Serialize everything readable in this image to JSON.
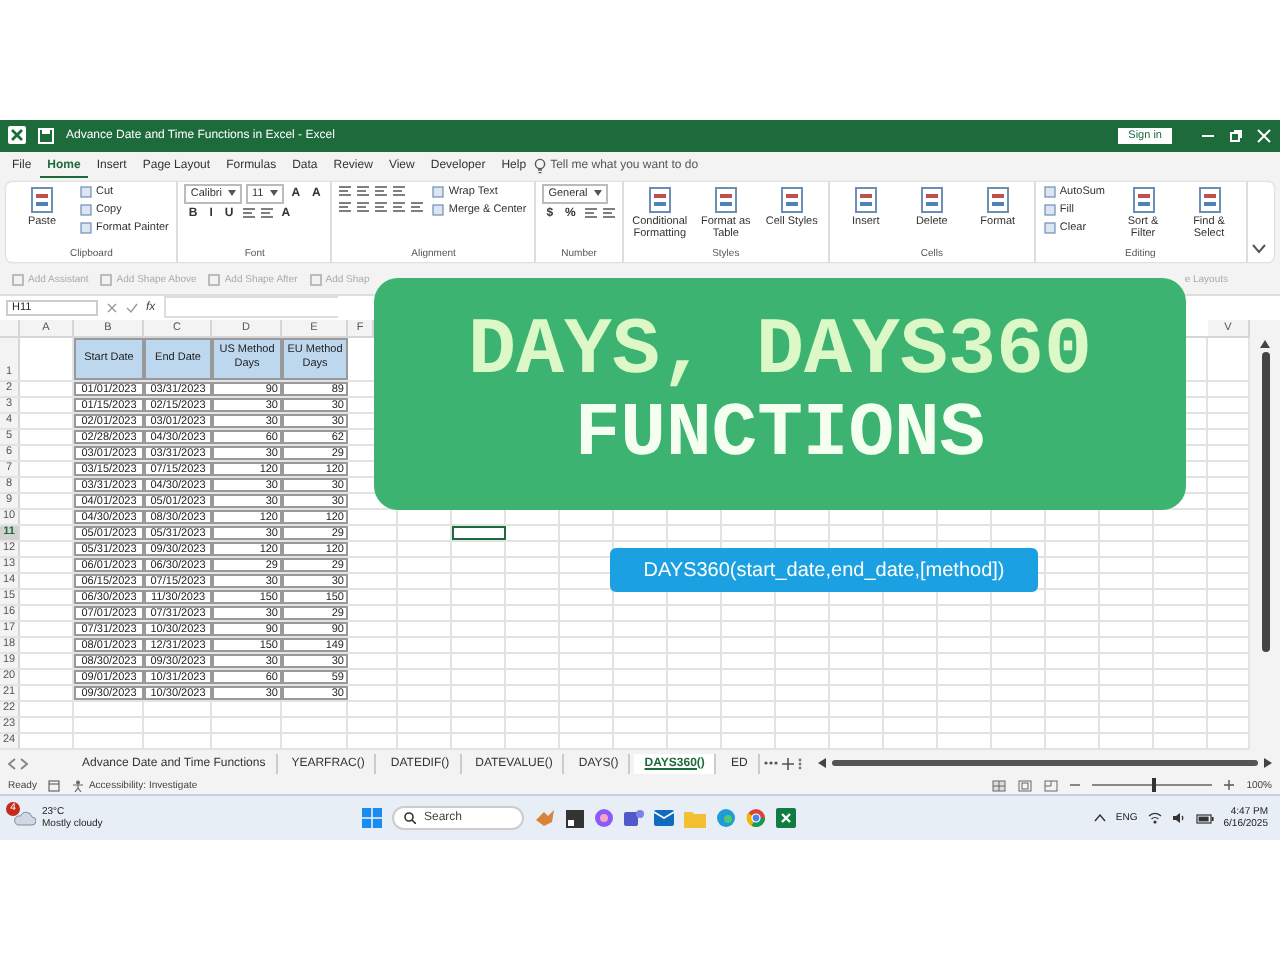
{
  "window": {
    "title": "Advance Date and Time Functions in Excel  -  Excel",
    "sign_in": "Sign in"
  },
  "menu": {
    "tabs": [
      {
        "label": "File",
        "selected": false
      },
      {
        "label": "Home",
        "selected": true
      },
      {
        "label": "Insert",
        "selected": false
      },
      {
        "label": "Page Layout",
        "selected": false
      },
      {
        "label": "Formulas",
        "selected": false
      },
      {
        "label": "Data",
        "selected": false
      },
      {
        "label": "Review",
        "selected": false
      },
      {
        "label": "View",
        "selected": false
      },
      {
        "label": "Developer",
        "selected": false
      },
      {
        "label": "Help",
        "selected": false
      }
    ],
    "tell_me": "Tell me what you want to do"
  },
  "ribbon": {
    "groups": [
      {
        "label": "Clipboard",
        "columns": [
          [
            [
              {
                "kind": "large",
                "label": "Paste"
              }
            ]
          ],
          [
            [
              {
                "kind": "small",
                "label": "Cut"
              }
            ],
            [
              {
                "kind": "small",
                "label": "Copy"
              }
            ],
            [
              {
                "kind": "small",
                "label": "Format Painter"
              }
            ]
          ]
        ]
      },
      {
        "label": "Font",
        "columns": [
          [
            [
              {
                "kind": "field",
                "label": "Calibri"
              },
              {
                "kind": "field",
                "label": "11"
              },
              {
                "kind": "glyph",
                "label": "A"
              },
              {
                "kind": "glyph",
                "label": "A"
              }
            ],
            [
              {
                "kind": "glyph",
                "label": "B"
              },
              {
                "kind": "glyph",
                "label": "I"
              },
              {
                "kind": "glyph",
                "label": "U"
              },
              {
                "kind": "tool"
              },
              {
                "kind": "tool"
              },
              {
                "kind": "glyph",
                "label": "A"
              }
            ]
          ]
        ]
      },
      {
        "label": "Alignment",
        "columns": [
          [
            [
              {
                "kind": "tool"
              },
              {
                "kind": "tool"
              },
              {
                "kind": "tool"
              },
              {
                "kind": "tool"
              }
            ],
            [
              {
                "kind": "tool"
              },
              {
                "kind": "tool"
              },
              {
                "kind": "tool"
              },
              {
                "kind": "tool"
              },
              {
                "kind": "tool"
              }
            ]
          ],
          [
            [
              {
                "kind": "small",
                "label": "Wrap Text"
              }
            ],
            [
              {
                "kind": "small",
                "label": "Merge & Center"
              }
            ]
          ]
        ]
      },
      {
        "label": "Number",
        "columns": [
          [
            [
              {
                "kind": "field",
                "label": "General"
              }
            ],
            [
              {
                "kind": "glyph",
                "label": "$"
              },
              {
                "kind": "glyph",
                "label": "%"
              },
              {
                "kind": "tool"
              },
              {
                "kind": "tool"
              }
            ]
          ]
        ]
      },
      {
        "label": "Styles",
        "columns": [
          [
            [
              {
                "kind": "large",
                "label": "Conditional Formatting"
              }
            ]
          ],
          [
            [
              {
                "kind": "large",
                "label": "Format as Table"
              }
            ]
          ],
          [
            [
              {
                "kind": "large",
                "label": "Cell Styles"
              }
            ]
          ]
        ]
      },
      {
        "label": "Cells",
        "columns": [
          [
            [
              {
                "kind": "large",
                "label": "Insert"
              }
            ]
          ],
          [
            [
              {
                "kind": "large",
                "label": "Delete"
              }
            ]
          ],
          [
            [
              {
                "kind": "large",
                "label": "Format"
              }
            ]
          ]
        ]
      },
      {
        "label": "Editing",
        "columns": [
          [
            [
              {
                "kind": "small",
                "label": "AutoSum"
              }
            ],
            [
              {
                "kind": "small",
                "label": "Fill"
              }
            ],
            [
              {
                "kind": "small",
                "label": "Clear"
              }
            ]
          ],
          [
            [
              {
                "kind": "large",
                "label": "Sort & Filter"
              }
            ]
          ],
          [
            [
              {
                "kind": "large",
                "label": "Find & Select"
              }
            ]
          ]
        ]
      }
    ]
  },
  "toolbar": {
    "items": [
      "Add Assistant",
      "Add Shape Above",
      "Add Shape After",
      "Add Shap"
    ],
    "right": "e Layouts"
  },
  "formula_bar": {
    "name_box": "H11",
    "function_label": "fx"
  },
  "sheet": {
    "column_headers": [
      "A",
      "B",
      "C",
      "D",
      "E",
      "F",
      "V"
    ],
    "rows": [
      {
        "header": "1",
        "kind": "header",
        "selected": false,
        "cells": [
          "Start Date",
          "End Date",
          "US Method Days",
          "EU Method Days"
        ]
      },
      {
        "header": "2",
        "kind": "data",
        "selected": false,
        "cells": [
          "01/01/2023",
          "03/31/2023",
          "90",
          "89"
        ]
      },
      {
        "header": "3",
        "kind": "data",
        "selected": false,
        "cells": [
          "01/15/2023",
          "02/15/2023",
          "30",
          "30"
        ]
      },
      {
        "header": "4",
        "kind": "data",
        "selected": false,
        "cells": [
          "02/01/2023",
          "03/01/2023",
          "30",
          "30"
        ]
      },
      {
        "header": "5",
        "kind": "data",
        "selected": false,
        "cells": [
          "02/28/2023",
          "04/30/2023",
          "60",
          "62"
        ]
      },
      {
        "header": "6",
        "kind": "data",
        "selected": false,
        "cells": [
          "03/01/2023",
          "03/31/2023",
          "30",
          "29"
        ]
      },
      {
        "header": "7",
        "kind": "data",
        "selected": false,
        "cells": [
          "03/15/2023",
          "07/15/2023",
          "120",
          "120"
        ]
      },
      {
        "header": "8",
        "kind": "data",
        "selected": false,
        "cells": [
          "03/31/2023",
          "04/30/2023",
          "30",
          "30"
        ]
      },
      {
        "header": "9",
        "kind": "data",
        "selected": false,
        "cells": [
          "04/01/2023",
          "05/01/2023",
          "30",
          "30"
        ]
      },
      {
        "header": "10",
        "kind": "data",
        "selected": false,
        "cells": [
          "04/30/2023",
          "08/30/2023",
          "120",
          "120"
        ]
      },
      {
        "header": "11",
        "kind": "data",
        "selected": true,
        "cells": [
          "05/01/2023",
          "05/31/2023",
          "30",
          "29"
        ]
      },
      {
        "header": "12",
        "kind": "data",
        "selected": false,
        "cells": [
          "05/31/2023",
          "09/30/2023",
          "120",
          "120"
        ]
      },
      {
        "header": "13",
        "kind": "data",
        "selected": false,
        "cells": [
          "06/01/2023",
          "06/30/2023",
          "29",
          "29"
        ]
      },
      {
        "header": "14",
        "kind": "data",
        "selected": false,
        "cells": [
          "06/15/2023",
          "07/15/2023",
          "30",
          "30"
        ]
      },
      {
        "header": "15",
        "kind": "data",
        "selected": false,
        "cells": [
          "06/30/2023",
          "11/30/2023",
          "150",
          "150"
        ]
      },
      {
        "header": "16",
        "kind": "data",
        "selected": false,
        "cells": [
          "07/01/2023",
          "07/31/2023",
          "30",
          "29"
        ]
      },
      {
        "header": "17",
        "kind": "data",
        "selected": false,
        "cells": [
          "07/31/2023",
          "10/30/2023",
          "90",
          "90"
        ]
      },
      {
        "header": "18",
        "kind": "data",
        "selected": false,
        "cells": [
          "08/01/2023",
          "12/31/2023",
          "150",
          "149"
        ]
      },
      {
        "header": "19",
        "kind": "data",
        "selected": false,
        "cells": [
          "08/30/2023",
          "09/30/2023",
          "30",
          "30"
        ]
      },
      {
        "header": "20",
        "kind": "data",
        "selected": false,
        "cells": [
          "09/01/2023",
          "10/31/2023",
          "60",
          "59"
        ]
      },
      {
        "header": "21",
        "kind": "data",
        "selected": false,
        "cells": [
          "09/30/2023",
          "10/30/2023",
          "30",
          "30"
        ]
      },
      {
        "header": "22",
        "kind": "empty",
        "selected": false
      },
      {
        "header": "23",
        "kind": "empty",
        "selected": false
      },
      {
        "header": "24",
        "kind": "empty",
        "selected": false
      }
    ]
  },
  "sheet_tabs": [
    {
      "label": "Advance Date and Time Functions",
      "selected": false
    },
    {
      "label": "YEARFRAC()",
      "selected": false
    },
    {
      "label": "DATEDIF()",
      "selected": false
    },
    {
      "label": "DATEVALUE()",
      "selected": false
    },
    {
      "label": "DAYS()",
      "selected": false
    },
    {
      "label": "DAYS360()",
      "selected": true
    },
    {
      "label": "ED",
      "selected": false
    }
  ],
  "status_bar": {
    "ready": "Ready",
    "accessibility": "Accessibility: Investigate",
    "zoom": {
      "level": 0.5,
      "reading": "100%"
    }
  },
  "banner": {
    "line_1": "DAYS, DAYS360",
    "line_2": "FUNCTIONS"
  },
  "syntax_box": "DAYS360(start_date,end_date,[method])",
  "taskbar": {
    "weather_badge": "4",
    "temperature": "23°C",
    "condition": "Mostly cloudy",
    "search": "Search",
    "language": "ENG",
    "time": "4:47 PM",
    "date": "6/16/2025"
  }
}
